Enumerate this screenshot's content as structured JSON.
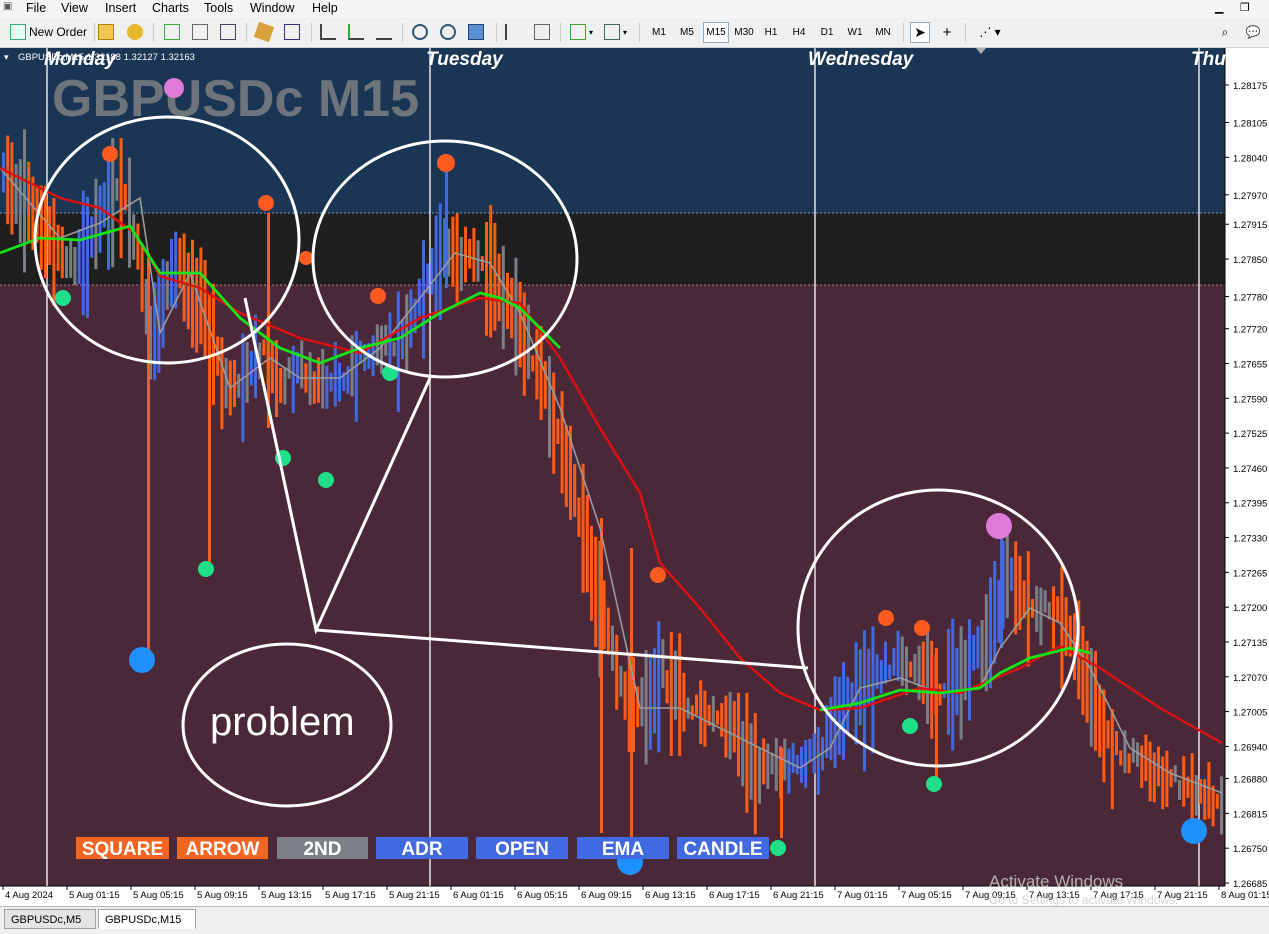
{
  "menu": {
    "items": [
      "File",
      "View",
      "Insert",
      "Charts",
      "Tools",
      "Window",
      "Help"
    ]
  },
  "toolbar": {
    "new_order_label": "New Order",
    "timeframes": [
      {
        "label": "M1",
        "active": false
      },
      {
        "label": "M5",
        "active": false
      },
      {
        "label": "M15",
        "active": true
      },
      {
        "label": "M30",
        "active": false
      },
      {
        "label": "H1",
        "active": false
      },
      {
        "label": "H4",
        "active": false
      },
      {
        "label": "D1",
        "active": false
      },
      {
        "label": "W1",
        "active": false
      },
      {
        "label": "MN",
        "active": false
      }
    ]
  },
  "chart": {
    "symbol_line": "GBPUSDc,M15 1.32188 1.32127 1.32163",
    "watermark": "GBPUSDc M15",
    "day_labels": [
      "Monday",
      "Tuesday",
      "Wednesday",
      "Thu"
    ],
    "price_ticks": [
      "1.28175",
      "1.28105",
      "1.28040",
      "1.27970",
      "1.27915",
      "1.27850",
      "1.27780",
      "1.27720",
      "1.27655",
      "1.27590",
      "1.27525",
      "1.27460",
      "1.27395",
      "1.27330",
      "1.27265",
      "1.27200",
      "1.27135",
      "1.27070",
      "1.27005",
      "1.26940",
      "1.26880",
      "1.26815",
      "1.26750",
      "1.26685"
    ],
    "time_ticks": [
      "4 Aug 2024",
      "5 Aug 01:15",
      "5 Aug 05:15",
      "5 Aug 09:15",
      "5 Aug 13:15",
      "5 Aug 17:15",
      "5 Aug 21:15",
      "6 Aug 01:15",
      "6 Aug 05:15",
      "6 Aug 09:15",
      "6 Aug 13:15",
      "6 Aug 17:15",
      "6 Aug 21:15",
      "7 Aug 01:15",
      "7 Aug 05:15",
      "7 Aug 09:15",
      "7 Aug 13:15",
      "7 Aug 17:15",
      "7 Aug 21:15",
      "8 Aug 01:15"
    ],
    "annotation_text": "problem",
    "legend_buttons": [
      {
        "label": "SQUARE",
        "color": "#f26522"
      },
      {
        "label": "ARROW",
        "color": "#f26522"
      },
      {
        "label": "2ND",
        "color": "#7b7f87"
      },
      {
        "label": "ADR",
        "color": "#4169e1"
      },
      {
        "label": "OPEN",
        "color": "#4169e1"
      },
      {
        "label": "EMA",
        "color": "#4169e1"
      },
      {
        "label": "CANDLE",
        "color": "#4169e1"
      }
    ],
    "activate_title": "Activate Windows",
    "activate_sub": "Go to Settings to activate Windows."
  },
  "tabs": [
    {
      "label": "GBPUSDc,M5",
      "active": false
    },
    {
      "label": "GBPUSDc,M15",
      "active": true
    }
  ],
  "colors": {
    "upper_zone": "#1b3654",
    "mid_zone": "#1f1f1f",
    "lower_zone": "#4b2838",
    "bull": "#4169e1",
    "bear": "#ff5b14",
    "neutral": "#7a7e86",
    "ema_red": "#e01010",
    "ema_green": "#17e317"
  }
}
